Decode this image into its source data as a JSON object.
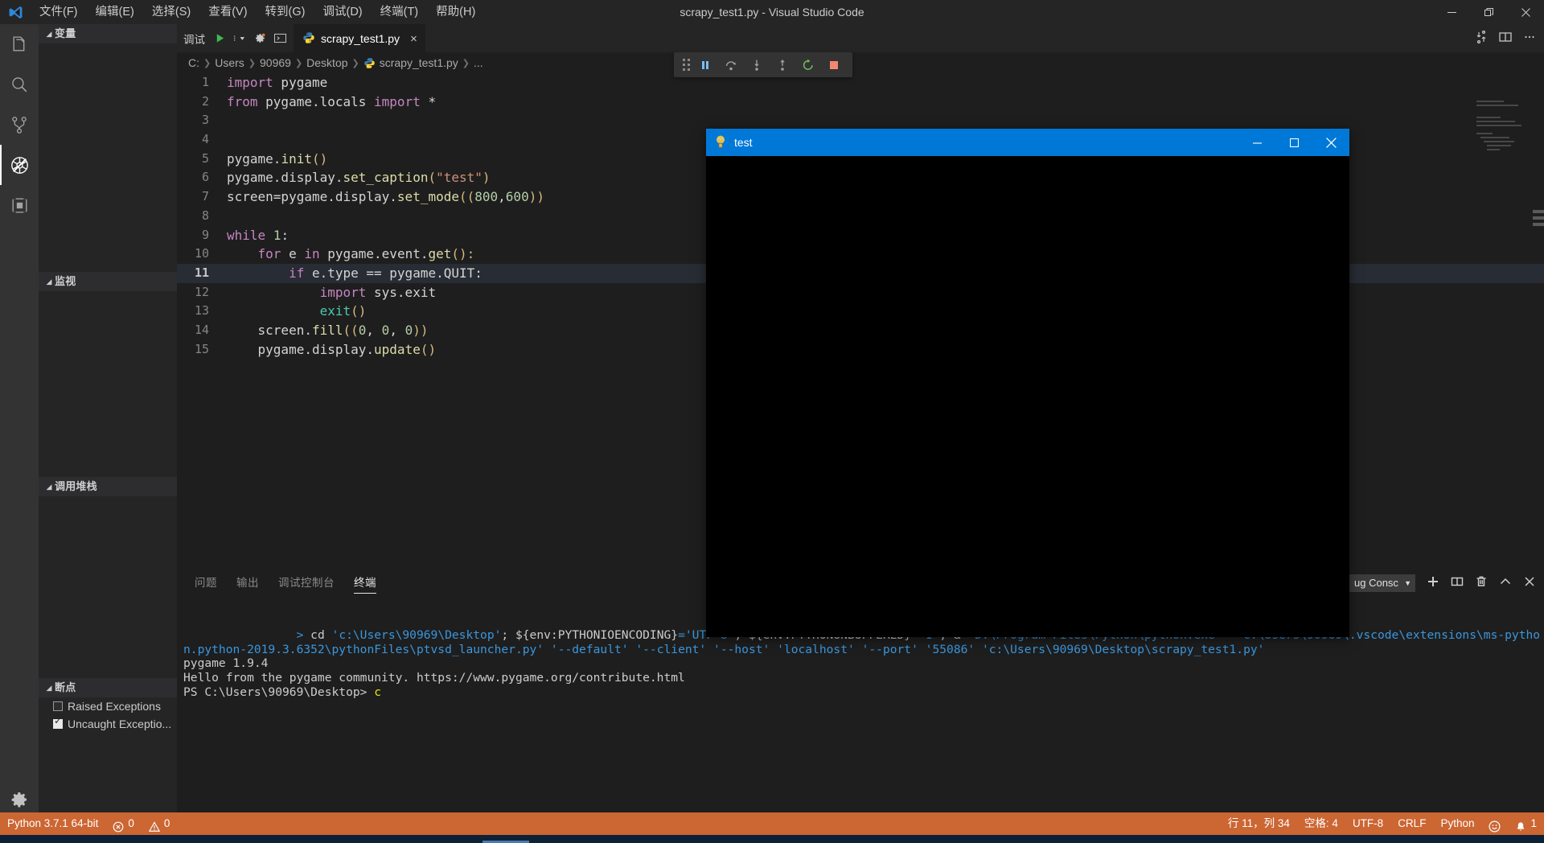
{
  "window": {
    "title": "scrapy_test1.py - Visual Studio Code",
    "controls": [
      "minimize",
      "restore",
      "close"
    ]
  },
  "menubar": {
    "logo_icon": "vscode-logo-icon",
    "items": [
      {
        "label": "文件(F)",
        "name": "menu-file"
      },
      {
        "label": "编辑(E)",
        "name": "menu-edit"
      },
      {
        "label": "选择(S)",
        "name": "menu-selection"
      },
      {
        "label": "查看(V)",
        "name": "menu-view"
      },
      {
        "label": "转到(G)",
        "name": "menu-go"
      },
      {
        "label": "调试(D)",
        "name": "menu-debug"
      },
      {
        "label": "终端(T)",
        "name": "menu-terminal"
      },
      {
        "label": "帮助(H)",
        "name": "menu-help"
      }
    ]
  },
  "activitybar": {
    "items": [
      {
        "icon": "files-explorer-icon",
        "name": "activity-explorer",
        "active": false
      },
      {
        "icon": "search-icon",
        "name": "activity-search",
        "active": false
      },
      {
        "icon": "source-control-icon",
        "name": "activity-source-control",
        "active": false
      },
      {
        "icon": "debug-icon",
        "name": "activity-debug",
        "active": true
      },
      {
        "icon": "extensions-icon",
        "name": "activity-extensions",
        "active": false
      }
    ],
    "settings_icon": "gear-icon"
  },
  "sidebar": {
    "sections": [
      {
        "label": "变量",
        "name": "debug-section-variables"
      },
      {
        "label": "监视",
        "name": "debug-section-watch"
      },
      {
        "label": "调用堆栈",
        "name": "debug-section-callstack"
      },
      {
        "label": "断点",
        "name": "debug-section-breakpoints"
      }
    ],
    "breakpoints": [
      {
        "label": "Raised Exceptions",
        "checked": false
      },
      {
        "label": "Uncaught Exceptio...",
        "checked": true
      }
    ]
  },
  "editor": {
    "debug_launch_label": "调试",
    "start_icon": "play-icon",
    "config_icon": "config-dropdown-icon",
    "gear_icon": "gear-icon",
    "console_icon": "open-console-icon",
    "tab": {
      "label": "scrapy_test1.py",
      "icon": "python-file-icon",
      "close_icon": "close-icon"
    },
    "tabbar_actions": [
      {
        "icon": "split-editor-icon",
        "name": "run-python-file-icon"
      },
      {
        "icon": "split-editor-icon",
        "name": "split-editor-icon"
      },
      {
        "icon": "more-actions-icon",
        "name": "more-actions-icon"
      }
    ],
    "breadcrumb": [
      "C:",
      "Users",
      "90969",
      "Desktop",
      "scrapy_test1.py",
      "..."
    ],
    "code": [
      {
        "n": "1",
        "tokens": [
          {
            "t": "import",
            "c": "k"
          },
          {
            "t": " pygame",
            "c": "pl"
          }
        ]
      },
      {
        "n": "2",
        "tokens": [
          {
            "t": "from",
            "c": "k"
          },
          {
            "t": " pygame.locals ",
            "c": "pl"
          },
          {
            "t": "import",
            "c": "k"
          },
          {
            "t": " *",
            "c": "pl"
          }
        ]
      },
      {
        "n": "3",
        "tokens": []
      },
      {
        "n": "4",
        "tokens": []
      },
      {
        "n": "5",
        "tokens": [
          {
            "t": "pygame.",
            "c": "pl"
          },
          {
            "t": "init",
            "c": "fn"
          },
          {
            "t": "()",
            "c": "br"
          }
        ]
      },
      {
        "n": "6",
        "tokens": [
          {
            "t": "pygame.display.",
            "c": "pl"
          },
          {
            "t": "set_caption",
            "c": "fn"
          },
          {
            "t": "(",
            "c": "br"
          },
          {
            "t": "\"test\"",
            "c": "s"
          },
          {
            "t": ")",
            "c": "br"
          }
        ]
      },
      {
        "n": "7",
        "tokens": [
          {
            "t": "screen=pygame.display.",
            "c": "pl"
          },
          {
            "t": "set_mode",
            "c": "fn"
          },
          {
            "t": "((",
            "c": "br"
          },
          {
            "t": "800",
            "c": "n"
          },
          {
            "t": ",",
            "c": "pl"
          },
          {
            "t": "600",
            "c": "n"
          },
          {
            "t": "))",
            "c": "br"
          }
        ]
      },
      {
        "n": "8",
        "tokens": []
      },
      {
        "n": "9",
        "tokens": [
          {
            "t": "while",
            "c": "k"
          },
          {
            "t": " ",
            "c": "pl"
          },
          {
            "t": "1",
            "c": "n"
          },
          {
            "t": ":",
            "c": "pl"
          }
        ]
      },
      {
        "n": "10",
        "tokens": [
          {
            "t": "    ",
            "c": "pl"
          },
          {
            "t": "for",
            "c": "k"
          },
          {
            "t": " e ",
            "c": "pl"
          },
          {
            "t": "in",
            "c": "k"
          },
          {
            "t": " pygame.event.",
            "c": "pl"
          },
          {
            "t": "get",
            "c": "fn"
          },
          {
            "t": "():",
            "c": "br"
          }
        ]
      },
      {
        "n": "11",
        "tokens": [
          {
            "t": "        ",
            "c": "pl"
          },
          {
            "t": "if",
            "c": "k"
          },
          {
            "t": " e.type == pygame.QUIT:",
            "c": "pl"
          }
        ],
        "highlight": true
      },
      {
        "n": "12",
        "tokens": [
          {
            "t": "            ",
            "c": "pl"
          },
          {
            "t": "import",
            "c": "k"
          },
          {
            "t": " sys.exit",
            "c": "pl"
          }
        ]
      },
      {
        "n": "13",
        "tokens": [
          {
            "t": "            ",
            "c": "pl"
          },
          {
            "t": "exit",
            "c": "cls"
          },
          {
            "t": "()",
            "c": "br"
          }
        ]
      },
      {
        "n": "14",
        "tokens": [
          {
            "t": "    screen.",
            "c": "pl"
          },
          {
            "t": "fill",
            "c": "fn"
          },
          {
            "t": "((",
            "c": "br"
          },
          {
            "t": "0",
            "c": "n"
          },
          {
            "t": ", ",
            "c": "pl"
          },
          {
            "t": "0",
            "c": "n"
          },
          {
            "t": ", ",
            "c": "pl"
          },
          {
            "t": "0",
            "c": "n"
          },
          {
            "t": "))",
            "c": "br"
          }
        ]
      },
      {
        "n": "15",
        "tokens": [
          {
            "t": "    pygame.display.",
            "c": "pl"
          },
          {
            "t": "update",
            "c": "fn"
          },
          {
            "t": "()",
            "c": "br"
          }
        ]
      }
    ]
  },
  "debug_toolbar": {
    "buttons": [
      {
        "name": "drag-handle-icon",
        "icon": "grip-icon"
      },
      {
        "name": "pause-button",
        "icon": "pause-icon",
        "color": "#75beff"
      },
      {
        "name": "step-over-button",
        "icon": "step-over-icon",
        "color": "#9aa0a6"
      },
      {
        "name": "step-into-button",
        "icon": "step-into-icon",
        "color": "#9aa0a6"
      },
      {
        "name": "step-out-button",
        "icon": "step-out-icon",
        "color": "#9aa0a6"
      },
      {
        "name": "restart-button",
        "icon": "restart-icon",
        "color": "#6bbf59"
      },
      {
        "name": "stop-button",
        "icon": "stop-icon",
        "color": "#f48771"
      }
    ]
  },
  "panel": {
    "tabs": [
      {
        "label": "问题",
        "name": "panel-tab-problems",
        "active": false
      },
      {
        "label": "输出",
        "name": "panel-tab-output",
        "active": false
      },
      {
        "label": "调试控制台",
        "name": "panel-tab-debug-console",
        "active": false
      },
      {
        "label": "终端",
        "name": "panel-tab-terminal",
        "active": true
      }
    ],
    "selector_value": "ug Consc",
    "actions": [
      {
        "name": "new-terminal-icon",
        "icon": "plus-icon"
      },
      {
        "name": "split-terminal-icon",
        "icon": "split-icon"
      },
      {
        "name": "kill-terminal-icon",
        "icon": "trash-icon"
      },
      {
        "name": "maximize-panel-icon",
        "icon": "chevron-up-icon"
      },
      {
        "name": "close-panel-icon",
        "icon": "close-icon"
      }
    ],
    "terminal_lines": [
      {
        "segments": [
          {
            "t": "                > ",
            "c": "t-cyan"
          },
          {
            "t": "cd ",
            "c": "t-white"
          },
          {
            "t": "'c:\\Users\\90969\\Desktop'",
            "c": "t-cyan"
          },
          {
            "t": "; ",
            "c": "t-white"
          },
          {
            "t": "${env:PYTHONIOENCODING}",
            "c": "t-white"
          },
          {
            "t": "=",
            "c": "t-cyan"
          },
          {
            "t": "'UTF-8'",
            "c": "t-cyan"
          },
          {
            "t": "; ",
            "c": "t-white"
          },
          {
            "t": "${env:PYTHONUNBUFFERED}",
            "c": "t-white"
          },
          {
            "t": "=",
            "c": "t-cyan"
          },
          {
            "t": "'1'",
            "c": "t-cyan"
          },
          {
            "t": "; & ",
            "c": "t-white"
          },
          {
            "t": "'D:\\Program Files\\Python\\python.exe'",
            "c": "t-cyan"
          },
          {
            "t": "  ",
            "c": "t-white"
          },
          {
            "t": "'c:\\Users\\90969\\.vscode\\extensions\\ms-python.python-2019.3.6352\\pythonFiles\\ptvsd_launcher.py'",
            "c": "t-cyan"
          },
          {
            "t": " ",
            "c": "t-white"
          },
          {
            "t": "'--default'",
            "c": "t-cyan"
          },
          {
            "t": " ",
            "c": "t-white"
          },
          {
            "t": "'--client'",
            "c": "t-cyan"
          },
          {
            "t": " ",
            "c": "t-white"
          },
          {
            "t": "'--host'",
            "c": "t-cyan"
          },
          {
            "t": " ",
            "c": "t-white"
          },
          {
            "t": "'localhost'",
            "c": "t-cyan"
          },
          {
            "t": " ",
            "c": "t-white"
          },
          {
            "t": "'--port'",
            "c": "t-cyan"
          },
          {
            "t": " ",
            "c": "t-white"
          },
          {
            "t": "'55086'",
            "c": "t-cyan"
          },
          {
            "t": " ",
            "c": "t-white"
          },
          {
            "t": "'c:\\Users\\90969\\Desktop\\scrapy_test1.py'",
            "c": "t-cyan"
          }
        ]
      },
      {
        "segments": [
          {
            "t": "pygame 1.9.4",
            "c": "t-gray"
          }
        ]
      },
      {
        "segments": [
          {
            "t": "Hello from the pygame community. https://www.pygame.org/contribute.html",
            "c": "t-gray"
          }
        ]
      },
      {
        "segments": [
          {
            "t": "PS C:\\Users\\90969\\Desktop> ",
            "c": "t-gray"
          },
          {
            "t": "c",
            "c": "t-yellow"
          }
        ]
      }
    ]
  },
  "pygame_window": {
    "title": "test",
    "icon": "pygame-icon",
    "controls": [
      {
        "name": "pygame-minimize-button",
        "icon": "minimize-icon"
      },
      {
        "name": "pygame-maximize-button",
        "icon": "maximize-icon"
      },
      {
        "name": "pygame-close-button",
        "icon": "close-icon"
      }
    ],
    "canvas_color": "#000000",
    "size": "800x600"
  },
  "statusbar": {
    "background": "#cc6633",
    "left": [
      {
        "label": "Python 3.7.1 64-bit",
        "name": "status-python-interpreter"
      },
      {
        "label": "0",
        "icon": "error-icon",
        "name": "status-errors"
      },
      {
        "label": "0",
        "icon": "warning-icon",
        "name": "status-warnings"
      }
    ],
    "right": [
      {
        "label": "行 11，列 34",
        "name": "status-cursor-position"
      },
      {
        "label": "空格: 4",
        "name": "status-indentation"
      },
      {
        "label": "UTF-8",
        "name": "status-encoding"
      },
      {
        "label": "CRLF",
        "name": "status-eol"
      },
      {
        "label": "Python",
        "name": "status-language-mode"
      },
      {
        "label": "",
        "icon": "smiley-icon",
        "name": "status-feedback"
      },
      {
        "label": "1",
        "icon": "bell-icon",
        "name": "status-notifications"
      }
    ]
  }
}
